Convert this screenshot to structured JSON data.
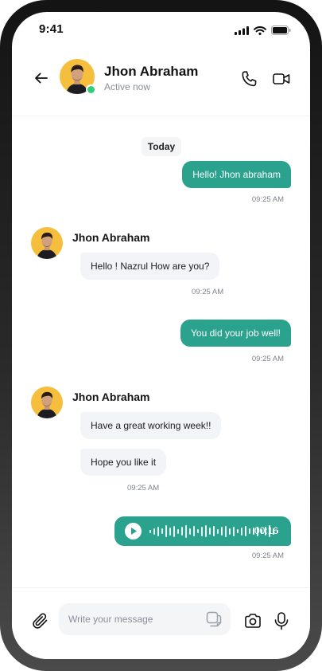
{
  "status_bar": {
    "time": "9:41"
  },
  "header": {
    "contact_name": "Jhon Abraham",
    "contact_status": "Active now"
  },
  "date_separator": "Today",
  "messages": [
    {
      "direction": "out",
      "text": "Hello! Jhon abraham",
      "time": "09:25 AM"
    },
    {
      "direction": "in",
      "sender": "Jhon Abraham",
      "text": "Hello ! Nazrul How are you?",
      "time": "09:25 AM"
    },
    {
      "direction": "out",
      "text": "You did your job well!",
      "time": "09:25 AM"
    },
    {
      "direction": "in",
      "sender": "Jhon Abraham",
      "texts": [
        "Have a great working week!!",
        "Hope you like it"
      ],
      "time": "09:25 AM"
    },
    {
      "direction": "out",
      "type": "voice",
      "duration": "00:16",
      "time": "09:25 AM"
    }
  ],
  "composer": {
    "placeholder": "Write your message"
  },
  "colors": {
    "accent": "#2aa28e",
    "incoming_bubble": "#f2f4f8",
    "avatar_bg": "#f5bf3d",
    "online": "#2fcf7a"
  },
  "icons": [
    "back-arrow-icon",
    "phone-icon",
    "video-camera-icon",
    "paperclip-icon",
    "sticker-icon",
    "camera-icon",
    "microphone-icon",
    "play-icon",
    "signal-icon",
    "wifi-icon",
    "battery-icon"
  ]
}
